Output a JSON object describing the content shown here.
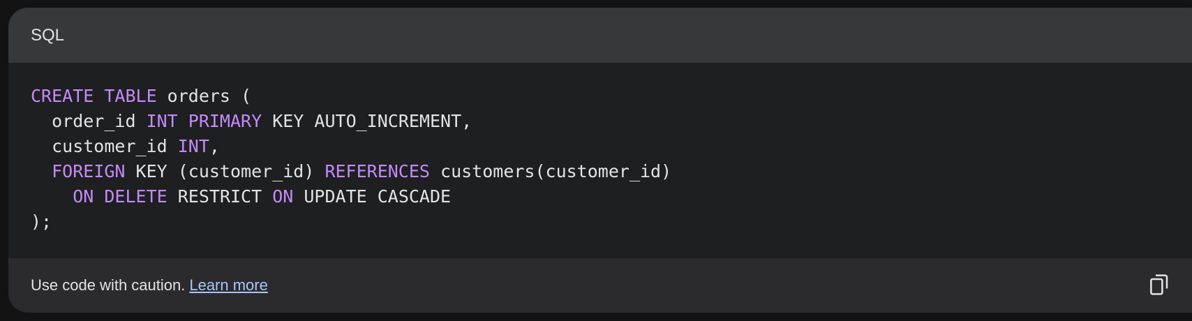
{
  "header": {
    "language": "SQL"
  },
  "code": {
    "lines": [
      [
        {
          "t": "CREATE TABLE",
          "k": "kw"
        },
        {
          "t": " orders (",
          "k": "id"
        }
      ],
      [
        {
          "t": "  order_id ",
          "k": "id"
        },
        {
          "t": "INT PRIMARY",
          "k": "kw"
        },
        {
          "t": " KEY AUTO_INCREMENT,",
          "k": "id"
        }
      ],
      [
        {
          "t": "  customer_id ",
          "k": "id"
        },
        {
          "t": "INT",
          "k": "kw"
        },
        {
          "t": ",",
          "k": "id"
        }
      ],
      [
        {
          "t": "  ",
          "k": "id"
        },
        {
          "t": "FOREIGN",
          "k": "kw"
        },
        {
          "t": " KEY (customer_id) ",
          "k": "id"
        },
        {
          "t": "REFERENCES",
          "k": "kw"
        },
        {
          "t": " customers(customer_id)",
          "k": "id"
        }
      ],
      [
        {
          "t": "    ",
          "k": "id"
        },
        {
          "t": "ON DELETE",
          "k": "kw"
        },
        {
          "t": " RESTRICT ",
          "k": "id"
        },
        {
          "t": "ON",
          "k": "kw"
        },
        {
          "t": " UPDATE CASCADE",
          "k": "id"
        }
      ],
      [
        {
          "t": ");",
          "k": "id"
        }
      ]
    ]
  },
  "footer": {
    "caution": "Use code with caution.",
    "learn_more": "Learn more",
    "copy_icon": "copy-icon"
  },
  "colors": {
    "keyword": "#c58af9",
    "text": "#e3e3e3",
    "link": "#a8c7fa",
    "header_bg": "#37383a",
    "body_bg": "#1e1f20",
    "footer_bg": "#2b2b2d"
  }
}
